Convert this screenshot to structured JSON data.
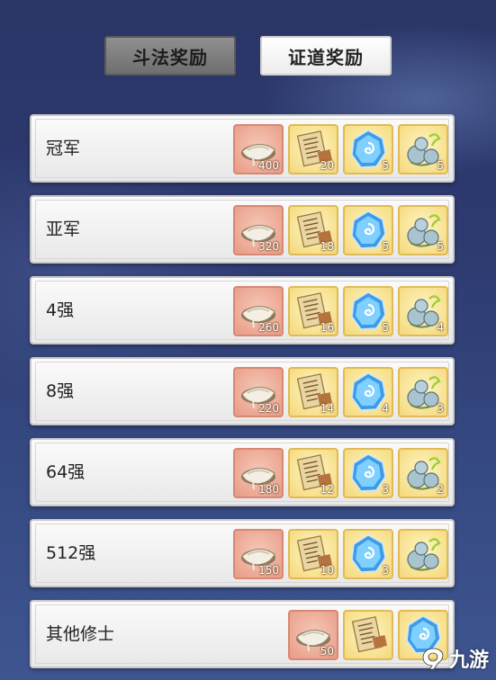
{
  "tabs": {
    "combat_rewards": "斗法奖励",
    "dao_rewards": "证道奖励"
  },
  "rows": [
    {
      "rank": "冠军",
      "items": [
        {
          "icon": "spirit-stone-icon",
          "qty": "400"
        },
        {
          "icon": "scroll-icon",
          "qty": "20"
        },
        {
          "icon": "blue-crystal-icon",
          "qty": "5"
        },
        {
          "icon": "gourd-icon",
          "qty": "5"
        }
      ]
    },
    {
      "rank": "亚军",
      "items": [
        {
          "icon": "spirit-stone-icon",
          "qty": "320"
        },
        {
          "icon": "scroll-icon",
          "qty": "18"
        },
        {
          "icon": "blue-crystal-icon",
          "qty": "5"
        },
        {
          "icon": "gourd-icon",
          "qty": "5"
        }
      ]
    },
    {
      "rank": "4强",
      "items": [
        {
          "icon": "spirit-stone-icon",
          "qty": "260"
        },
        {
          "icon": "scroll-icon",
          "qty": "16"
        },
        {
          "icon": "blue-crystal-icon",
          "qty": "5"
        },
        {
          "icon": "gourd-icon",
          "qty": "4"
        }
      ]
    },
    {
      "rank": "8强",
      "items": [
        {
          "icon": "spirit-stone-icon",
          "qty": "220"
        },
        {
          "icon": "scroll-icon",
          "qty": "14"
        },
        {
          "icon": "blue-crystal-icon",
          "qty": "4"
        },
        {
          "icon": "gourd-icon",
          "qty": "3"
        }
      ]
    },
    {
      "rank": "64强",
      "items": [
        {
          "icon": "spirit-stone-icon",
          "qty": "180"
        },
        {
          "icon": "scroll-icon",
          "qty": "12"
        },
        {
          "icon": "blue-crystal-icon",
          "qty": "3"
        },
        {
          "icon": "gourd-icon",
          "qty": "2"
        }
      ]
    },
    {
      "rank": "512强",
      "items": [
        {
          "icon": "spirit-stone-icon",
          "qty": "150"
        },
        {
          "icon": "scroll-icon",
          "qty": "10"
        },
        {
          "icon": "blue-crystal-icon",
          "qty": "3"
        },
        {
          "icon": "gourd-icon",
          "qty": ""
        }
      ]
    },
    {
      "rank": "其他修士",
      "items": [
        {
          "icon": "spirit-stone-icon",
          "qty": "50"
        },
        {
          "icon": "scroll-icon",
          "qty": ""
        },
        {
          "icon": "blue-crystal-icon",
          "qty": ""
        }
      ]
    }
  ],
  "watermark": {
    "text": "九游",
    "icon": "9game-logo-icon"
  }
}
